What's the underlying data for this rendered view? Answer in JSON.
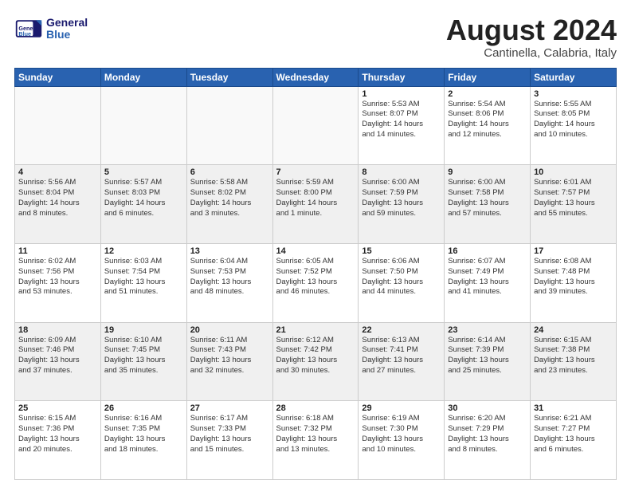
{
  "logo": {
    "text_general": "General",
    "text_blue": "Blue"
  },
  "header": {
    "month": "August 2024",
    "location": "Cantinella, Calabria, Italy"
  },
  "weekdays": [
    "Sunday",
    "Monday",
    "Tuesday",
    "Wednesday",
    "Thursday",
    "Friday",
    "Saturday"
  ],
  "weeks": [
    {
      "shaded": false,
      "days": [
        {
          "date": "",
          "info": ""
        },
        {
          "date": "",
          "info": ""
        },
        {
          "date": "",
          "info": ""
        },
        {
          "date": "",
          "info": ""
        },
        {
          "date": "1",
          "info": "Sunrise: 5:53 AM\nSunset: 8:07 PM\nDaylight: 14 hours\nand 14 minutes."
        },
        {
          "date": "2",
          "info": "Sunrise: 5:54 AM\nSunset: 8:06 PM\nDaylight: 14 hours\nand 12 minutes."
        },
        {
          "date": "3",
          "info": "Sunrise: 5:55 AM\nSunset: 8:05 PM\nDaylight: 14 hours\nand 10 minutes."
        }
      ]
    },
    {
      "shaded": true,
      "days": [
        {
          "date": "4",
          "info": "Sunrise: 5:56 AM\nSunset: 8:04 PM\nDaylight: 14 hours\nand 8 minutes."
        },
        {
          "date": "5",
          "info": "Sunrise: 5:57 AM\nSunset: 8:03 PM\nDaylight: 14 hours\nand 6 minutes."
        },
        {
          "date": "6",
          "info": "Sunrise: 5:58 AM\nSunset: 8:02 PM\nDaylight: 14 hours\nand 3 minutes."
        },
        {
          "date": "7",
          "info": "Sunrise: 5:59 AM\nSunset: 8:00 PM\nDaylight: 14 hours\nand 1 minute."
        },
        {
          "date": "8",
          "info": "Sunrise: 6:00 AM\nSunset: 7:59 PM\nDaylight: 13 hours\nand 59 minutes."
        },
        {
          "date": "9",
          "info": "Sunrise: 6:00 AM\nSunset: 7:58 PM\nDaylight: 13 hours\nand 57 minutes."
        },
        {
          "date": "10",
          "info": "Sunrise: 6:01 AM\nSunset: 7:57 PM\nDaylight: 13 hours\nand 55 minutes."
        }
      ]
    },
    {
      "shaded": false,
      "days": [
        {
          "date": "11",
          "info": "Sunrise: 6:02 AM\nSunset: 7:56 PM\nDaylight: 13 hours\nand 53 minutes."
        },
        {
          "date": "12",
          "info": "Sunrise: 6:03 AM\nSunset: 7:54 PM\nDaylight: 13 hours\nand 51 minutes."
        },
        {
          "date": "13",
          "info": "Sunrise: 6:04 AM\nSunset: 7:53 PM\nDaylight: 13 hours\nand 48 minutes."
        },
        {
          "date": "14",
          "info": "Sunrise: 6:05 AM\nSunset: 7:52 PM\nDaylight: 13 hours\nand 46 minutes."
        },
        {
          "date": "15",
          "info": "Sunrise: 6:06 AM\nSunset: 7:50 PM\nDaylight: 13 hours\nand 44 minutes."
        },
        {
          "date": "16",
          "info": "Sunrise: 6:07 AM\nSunset: 7:49 PM\nDaylight: 13 hours\nand 41 minutes."
        },
        {
          "date": "17",
          "info": "Sunrise: 6:08 AM\nSunset: 7:48 PM\nDaylight: 13 hours\nand 39 minutes."
        }
      ]
    },
    {
      "shaded": true,
      "days": [
        {
          "date": "18",
          "info": "Sunrise: 6:09 AM\nSunset: 7:46 PM\nDaylight: 13 hours\nand 37 minutes."
        },
        {
          "date": "19",
          "info": "Sunrise: 6:10 AM\nSunset: 7:45 PM\nDaylight: 13 hours\nand 35 minutes."
        },
        {
          "date": "20",
          "info": "Sunrise: 6:11 AM\nSunset: 7:43 PM\nDaylight: 13 hours\nand 32 minutes."
        },
        {
          "date": "21",
          "info": "Sunrise: 6:12 AM\nSunset: 7:42 PM\nDaylight: 13 hours\nand 30 minutes."
        },
        {
          "date": "22",
          "info": "Sunrise: 6:13 AM\nSunset: 7:41 PM\nDaylight: 13 hours\nand 27 minutes."
        },
        {
          "date": "23",
          "info": "Sunrise: 6:14 AM\nSunset: 7:39 PM\nDaylight: 13 hours\nand 25 minutes."
        },
        {
          "date": "24",
          "info": "Sunrise: 6:15 AM\nSunset: 7:38 PM\nDaylight: 13 hours\nand 23 minutes."
        }
      ]
    },
    {
      "shaded": false,
      "days": [
        {
          "date": "25",
          "info": "Sunrise: 6:15 AM\nSunset: 7:36 PM\nDaylight: 13 hours\nand 20 minutes."
        },
        {
          "date": "26",
          "info": "Sunrise: 6:16 AM\nSunset: 7:35 PM\nDaylight: 13 hours\nand 18 minutes."
        },
        {
          "date": "27",
          "info": "Sunrise: 6:17 AM\nSunset: 7:33 PM\nDaylight: 13 hours\nand 15 minutes."
        },
        {
          "date": "28",
          "info": "Sunrise: 6:18 AM\nSunset: 7:32 PM\nDaylight: 13 hours\nand 13 minutes."
        },
        {
          "date": "29",
          "info": "Sunrise: 6:19 AM\nSunset: 7:30 PM\nDaylight: 13 hours\nand 10 minutes."
        },
        {
          "date": "30",
          "info": "Sunrise: 6:20 AM\nSunset: 7:29 PM\nDaylight: 13 hours\nand 8 minutes."
        },
        {
          "date": "31",
          "info": "Sunrise: 6:21 AM\nSunset: 7:27 PM\nDaylight: 13 hours\nand 6 minutes."
        }
      ]
    }
  ]
}
